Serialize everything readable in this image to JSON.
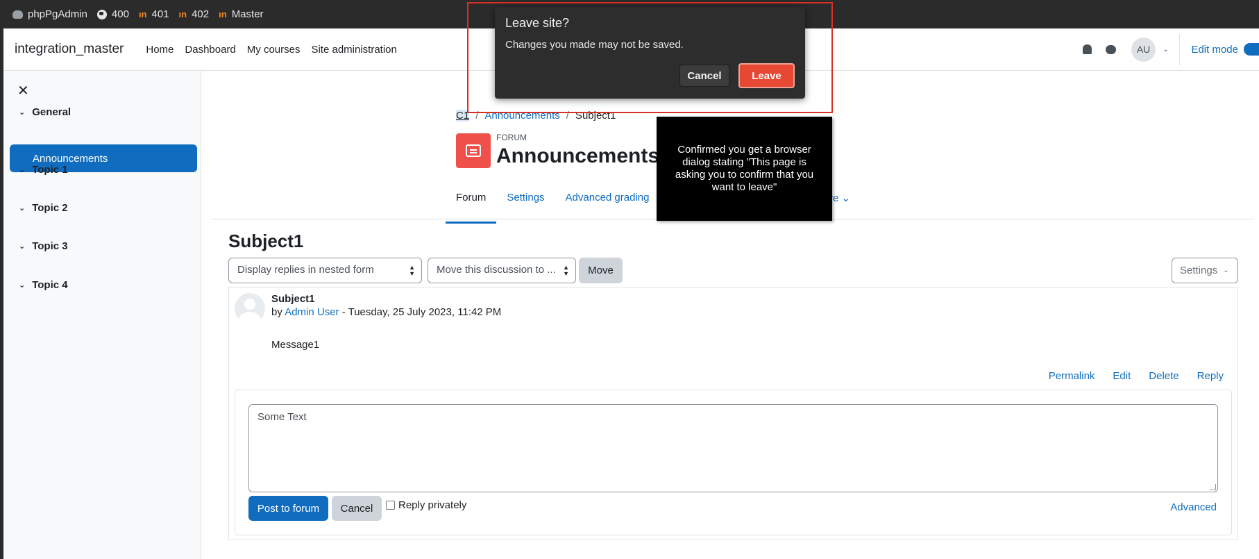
{
  "bookmarks": [
    {
      "label": "phpPgAdmin",
      "icon": "elephant-icon"
    },
    {
      "label": "400",
      "icon": "globe-icon"
    },
    {
      "label": "401",
      "icon": "in-icon"
    },
    {
      "label": "402",
      "icon": "in-icon"
    },
    {
      "label": "Master",
      "icon": "in-icon"
    }
  ],
  "navbar": {
    "brand": "integration_master",
    "links": [
      "Home",
      "Dashboard",
      "My courses",
      "Site administration"
    ],
    "avatar_initials": "AU",
    "edit_mode": "Edit mode"
  },
  "sidebar": {
    "close": "✕",
    "sections": [
      {
        "label": "General"
      },
      {
        "label": "Announcements",
        "active": true
      },
      {
        "label": "Topic 1"
      },
      {
        "label": "Topic 2"
      },
      {
        "label": "Topic 3"
      },
      {
        "label": "Topic 4"
      }
    ]
  },
  "breadcrumb": [
    "C1",
    "Announcements",
    "Subject1"
  ],
  "forum": {
    "label": "FORUM",
    "title": "Announcements",
    "icon": "forum-chat-icon"
  },
  "tabs": [
    "Forum",
    "Settings",
    "Advanced grading"
  ],
  "tab_more": "re ⌄",
  "discussion": {
    "subject": "Subject1",
    "display_select": "Display replies in nested form",
    "move_select": "Move this discussion to ...",
    "move_button": "Move",
    "settings_button": "Settings"
  },
  "post": {
    "title": "Subject1",
    "by_prefix": "by ",
    "author": "Admin User",
    "date": " - Tuesday, 25 July 2023, 11:42 PM",
    "message": "Message1",
    "actions": [
      "Permalink",
      "Edit",
      "Delete",
      "Reply"
    ]
  },
  "reply": {
    "text": "Some Text",
    "post_button": "Post to forum",
    "cancel_button": "Cancel",
    "reply_privately": "Reply privately",
    "advanced": "Advanced"
  },
  "callout": {
    "text": "Confirmed you get a browser dialog stating \"This page is asking you to confirm that you want to leave\""
  },
  "dialog": {
    "title": "Leave site?",
    "message": "Changes you made may not be saved.",
    "cancel": "Cancel",
    "leave": "Leave"
  },
  "colors": {
    "primary": "#0f6cbf",
    "forum_icon": "#f0504a",
    "dialog_bg": "#2d2d2d",
    "leave_button": "#e64833",
    "highlight": "#d93025"
  }
}
